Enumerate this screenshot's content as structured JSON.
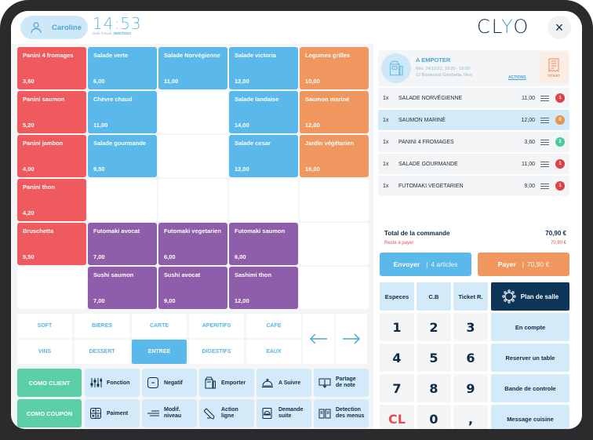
{
  "header": {
    "user_name": "Caroline",
    "time": "14:53",
    "date_label": "Date Travail,",
    "date_value": "29/07/2022",
    "logo_left": "CL",
    "logo_y": "Y",
    "logo_right": "O",
    "close_label": "×"
  },
  "products": [
    {
      "name": "Panini 4 fromages",
      "price": "3,60",
      "color": "red"
    },
    {
      "name": "Salade verte",
      "price": "6,00",
      "color": "blue"
    },
    {
      "name": "Salade Norvégienne",
      "price": "11,00",
      "color": "blue"
    },
    {
      "name": "Salade victoria",
      "price": "12,00",
      "color": "blue"
    },
    {
      "name": "Legumes grilles",
      "price": "10,00",
      "color": "orange"
    },
    {
      "name": "Panini saumon",
      "price": "5,20",
      "color": "red"
    },
    {
      "name": "Chèvre chaud",
      "price": "11,00",
      "color": "blue"
    },
    {
      "name": "",
      "price": "",
      "color": "empty"
    },
    {
      "name": "Salade landaise",
      "price": "14,00",
      "color": "blue"
    },
    {
      "name": "Saumon mariné",
      "price": "12,00",
      "color": "orange"
    },
    {
      "name": "Panini jambon",
      "price": "4,00",
      "color": "red"
    },
    {
      "name": "Salade gourmande",
      "price": "9,50",
      "color": "blue"
    },
    {
      "name": "",
      "price": "",
      "color": "empty"
    },
    {
      "name": "Salade cesar",
      "price": "12,00",
      "color": "blue"
    },
    {
      "name": "Jardin végétarien",
      "price": "16,00",
      "color": "orange"
    },
    {
      "name": "Panini thon",
      "price": "4,20",
      "color": "red"
    },
    {
      "name": "",
      "price": "",
      "color": "empty"
    },
    {
      "name": "",
      "price": "",
      "color": "empty"
    },
    {
      "name": "",
      "price": "",
      "color": "empty"
    },
    {
      "name": "",
      "price": "",
      "color": "empty"
    },
    {
      "name": "Bruschetta",
      "price": "9,50",
      "color": "red"
    },
    {
      "name": "Futomaki avocat",
      "price": "7,00",
      "color": "purple"
    },
    {
      "name": "Futomaki vegetarien",
      "price": "6,00",
      "color": "purple"
    },
    {
      "name": "Futomaki saumon",
      "price": "6,00",
      "color": "purple"
    },
    {
      "name": "",
      "price": "",
      "color": "empty"
    },
    {
      "name": "",
      "price": "",
      "color": "empty"
    },
    {
      "name": "Sushi saumon",
      "price": "7,00",
      "color": "purple"
    },
    {
      "name": "Sushi avocat",
      "price": "9,00",
      "color": "purple"
    },
    {
      "name": "Sashimi thon",
      "price": "12,00",
      "color": "purple"
    },
    {
      "name": "",
      "price": "",
      "color": "empty"
    }
  ],
  "categories": [
    {
      "label": "SOFT",
      "active": false
    },
    {
      "label": "BIERES",
      "active": false
    },
    {
      "label": "CARTE",
      "active": false
    },
    {
      "label": "APERITIFS",
      "active": false
    },
    {
      "label": "CAFE",
      "active": false
    },
    {
      "label": "VINS",
      "active": false
    },
    {
      "label": "DESSERT",
      "active": false
    },
    {
      "label": "ENTREE",
      "active": true
    },
    {
      "label": "DIGESTIFS",
      "active": false
    },
    {
      "label": "EAUX",
      "active": false
    }
  ],
  "actions": {
    "como_client": "COMO CLIENT",
    "como_coupon": "COMO COUPON",
    "fonction": "Fonction",
    "negatif": "Negatif",
    "emporter": "Emporter",
    "a_suivre": "A Suivre",
    "partage_1": "Partage",
    "partage_2": "de note",
    "paiment": "Paiment",
    "modif_1": "Modif.",
    "modif_2": "niveau",
    "action_1": "Action",
    "action_2": "ligne",
    "demande_1": "Demande",
    "demande_2": "suite",
    "detection_1": "Detection",
    "detection_2": "des menus"
  },
  "order": {
    "type": "A EMPOTER",
    "datetime": "Mer. 24/12/22,  18:20 - 18:50",
    "address": "13 Boulevard Gambetta, Nice",
    "actions_link": "ACTIONS",
    "ticket_label": "TICKET",
    "lines": [
      {
        "qty": "1x",
        "name": "SALADE NORVÉGIENNE",
        "price": "11,00",
        "badge": "1",
        "badge_color": "#e0404a",
        "selected": false
      },
      {
        "qty": "1x",
        "name": "SAUMON MARINÉ",
        "price": "12,00",
        "badge": "0",
        "badge_color": "#e8944e",
        "selected": true
      },
      {
        "qty": "1x",
        "name": "PANINI 4 FROMAGES",
        "price": "3,60",
        "badge": "2",
        "badge_color": "#4cc99a",
        "selected": false
      },
      {
        "qty": "1x",
        "name": "SALADE GOURMANDE",
        "price": "11,00",
        "badge": "1",
        "badge_color": "#e0404a",
        "selected": false
      },
      {
        "qty": "1x",
        "name": "FUTOMAKI VEGETARIEN",
        "price": "9,00",
        "badge": "1",
        "badge_color": "#e0404a",
        "selected": false
      }
    ],
    "total_label": "Total de la commande",
    "total_value": "70,90 €",
    "rest_label": "Reste à payer",
    "rest_value": "70,90 €",
    "send_label": "Envoyer",
    "send_sep": "|",
    "send_sub": "4 articles",
    "pay_label": "Payer",
    "pay_sep": "|",
    "pay_sub": "70,90 €"
  },
  "keypad": {
    "especes": "Especes",
    "cb": "C.B",
    "ticket_r": "Ticket R.",
    "plan_de_salle": "Plan de salle",
    "keys": [
      "1",
      "2",
      "3",
      "4",
      "5",
      "6",
      "7",
      "8",
      "9",
      "CL",
      "0",
      ","
    ],
    "en_compte": "En compte",
    "reserver": "Reserver un table",
    "bande": "Bande de controle",
    "message": "Message cuisine"
  },
  "colors": {
    "red": "#ef5a5e",
    "blue": "#5bb8ea",
    "orange": "#f0975f",
    "purple": "#8f5eab",
    "green": "#5dcfa7",
    "navy": "#0e3658"
  }
}
